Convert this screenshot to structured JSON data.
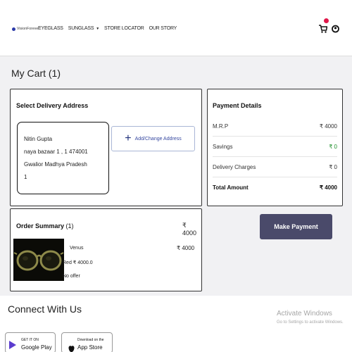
{
  "header": {
    "logo_text": "VisionForever",
    "nav": [
      {
        "label": "EYEGLASS"
      },
      {
        "label": "SUNGLASS",
        "caret": "▼"
      },
      {
        "label": "STORE LOCATOR"
      },
      {
        "label": "OUR STORY"
      }
    ],
    "cart_icon": "shopping-cart-icon",
    "user_icon": "user-icon",
    "badge_color": "#e0174a"
  },
  "page_title": "My Cart (1)",
  "delivery": {
    "title": "Select Delivery Address",
    "address_lines": [
      "Nitin Gupta",
      "naya bazaar 1 , 1 474001",
      "Gwalior Madhya Pradesh",
      "1"
    ],
    "add_change_label": "Add/Change Address"
  },
  "payment": {
    "title": "Payment Details",
    "rows": [
      {
        "label": "M.R.P",
        "value": "₹ 4000"
      },
      {
        "label": "Savings",
        "value": "₹ 0"
      },
      {
        "label": "Delivery Charges",
        "value": "₹ 0"
      }
    ],
    "total_label": "Total Amount",
    "total_value": "₹ 4000",
    "button_label": "Make Payment",
    "button_color": "#4a4a6a",
    "savings_color": "#1d8f2a"
  },
  "order_summary": {
    "title": "Order Summary",
    "count": "(1)",
    "total": "₹ 4000",
    "item": {
      "name": "Venus",
      "price": "₹ 4000",
      "frame_color": "Red",
      "sub_price": "₹ 4000.0",
      "offer": "No offer"
    }
  },
  "footer": {
    "connect_title": "Connect With Us",
    "google_play": {
      "line1": "GET IT ON",
      "line2": "Google Play"
    },
    "app_store": {
      "line1": "Download on the",
      "line2": "App Store"
    }
  },
  "watermark": {
    "line1": "Activate Windows",
    "line2": "Go to Settings to activate Windows."
  }
}
